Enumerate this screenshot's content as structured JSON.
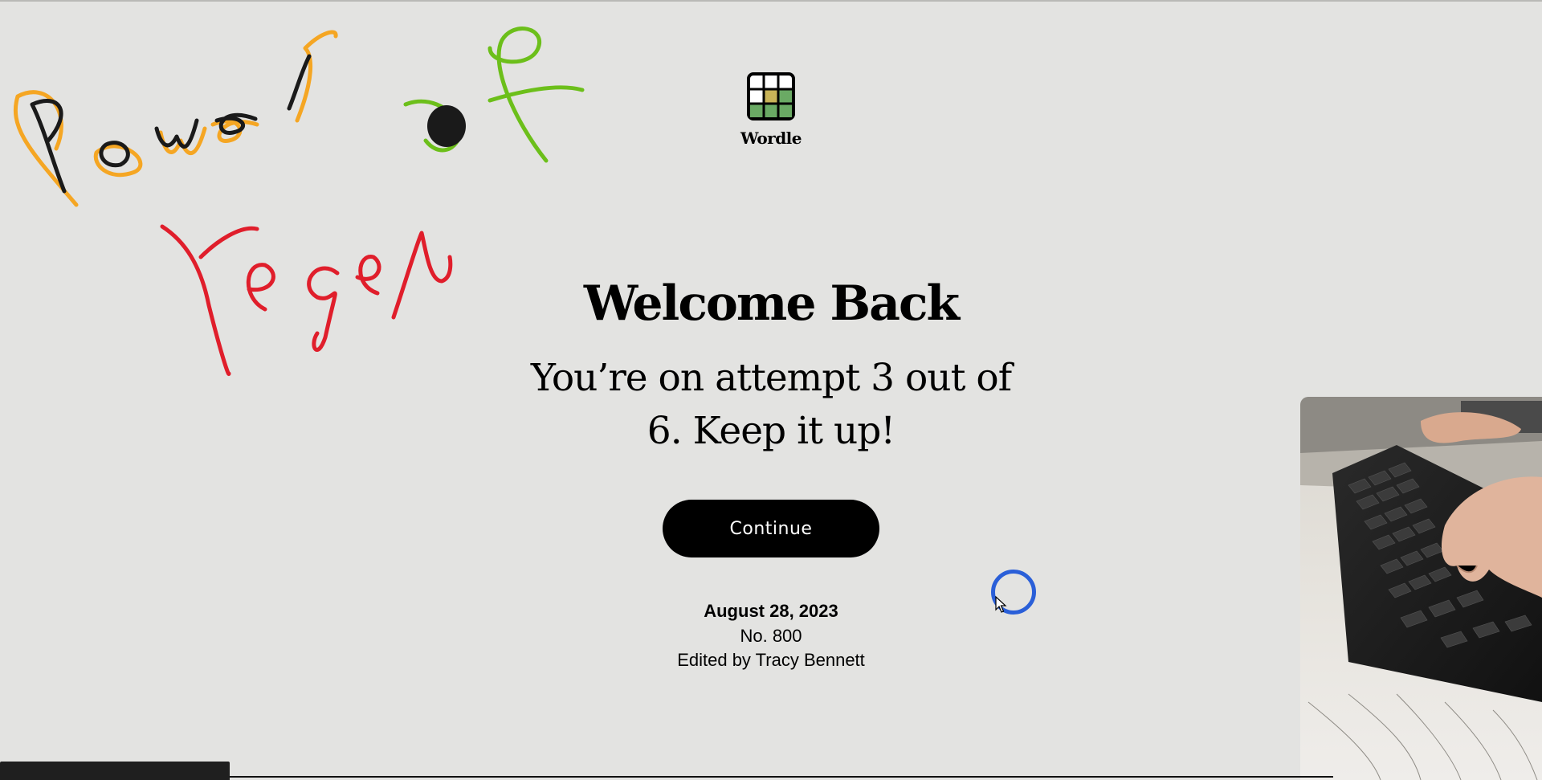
{
  "app": {
    "name": "Wordle"
  },
  "welcome": {
    "title": "Welcome Back",
    "message": "You’re on attempt 3 out of 6. Keep it up!",
    "continue_label": "Continue"
  },
  "puzzle": {
    "date": "August 28, 2023",
    "number": "No. 800",
    "editor": "Edited by Tracy Bennett"
  },
  "annotation": {
    "line1": "Power of",
    "line2": "regex",
    "colors": {
      "black": "#1a1a1a",
      "orange": "#f5a623",
      "green": "#6cbf1a",
      "red": "#e01e2b"
    }
  },
  "icons": {
    "logo": "wordle-grid-icon",
    "cursor": "mouse-pointer-icon"
  },
  "colors": {
    "background": "#e3e3e1",
    "button": "#000000",
    "tile_green": "#6aaa64",
    "tile_yellow": "#c9b458",
    "click_ring": "#2a5fd8"
  }
}
